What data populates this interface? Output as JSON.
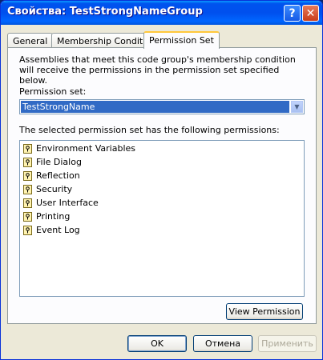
{
  "window": {
    "title": "Свойства: TestStrongNameGroup",
    "help_glyph": "?",
    "close_glyph": "✕"
  },
  "tabs": [
    {
      "label": "General",
      "active": false
    },
    {
      "label": "Membership Condition",
      "active": false
    },
    {
      "label": "Permission Set",
      "active": true
    }
  ],
  "panel": {
    "description": "Assemblies that meet this code group's membership condition will receive the permissions in the permission set specified below.",
    "permission_set_label": "Permission set:",
    "permission_set_value": "TestStrongName",
    "permissions_label": "The selected permission set has the following permissions:",
    "permissions": [
      "Environment Variables",
      "File Dialog",
      "Reflection",
      "Security",
      "User Interface",
      "Printing",
      "Event Log"
    ],
    "view_permission_button": "View Permission"
  },
  "footer": {
    "ok": "OK",
    "cancel": "Отмена",
    "apply": "Применить"
  },
  "colors": {
    "title_bar": "#0054e3",
    "selection": "#316ac5",
    "dialog_bg": "#ece9d8"
  }
}
